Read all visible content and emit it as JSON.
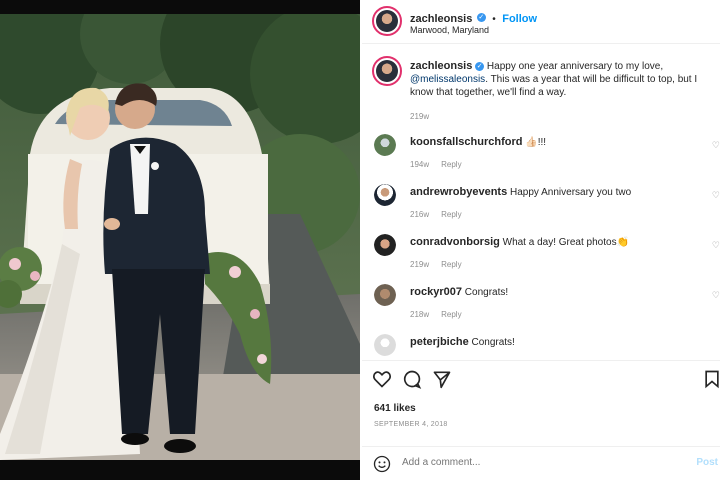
{
  "photo": {
    "alt_icon": "wedding-photo"
  },
  "post": {
    "username": "zachleonsis",
    "follow_label": "Follow",
    "separator": "•",
    "location": "Marwood, Maryland",
    "verified_glyph": "✓"
  },
  "caption": {
    "username": "zachleonsis",
    "text_before": "Happy one year anniversary to my love,",
    "mention": "@melissaleonsis",
    "text_after": ". This was a year that will be difficult to top, but I know that together, we'll find a way.",
    "time": "219w"
  },
  "comments": [
    {
      "username": "koonsfallschurchford",
      "text": "👍🏻!!!",
      "time": "194w",
      "reply": "Reply"
    },
    {
      "username": "andrewrobyevents",
      "text": "Happy Anniversary you two",
      "time": "216w",
      "reply": "Reply"
    },
    {
      "username": "conradvonborsig",
      "text": "What a day! Great photos👏",
      "time": "219w",
      "reply": "Reply"
    },
    {
      "username": "rockyr007",
      "text": "Congrats!",
      "time": "218w",
      "reply": "Reply"
    },
    {
      "username": "peterjbiche",
      "text": "Congrats!",
      "time": "",
      "reply": ""
    }
  ],
  "actions": {
    "likes": "641 likes",
    "date": "SEPTEMBER 4, 2018",
    "icons": [
      "heart-icon",
      "comment-icon",
      "share-icon",
      "bookmark-icon"
    ]
  },
  "add_comment": {
    "placeholder": "Add a comment...",
    "post_label": "Post"
  },
  "colors": {
    "accent": "#0095f6",
    "verified": "#3897f0",
    "muted": "#8e8e8e"
  }
}
